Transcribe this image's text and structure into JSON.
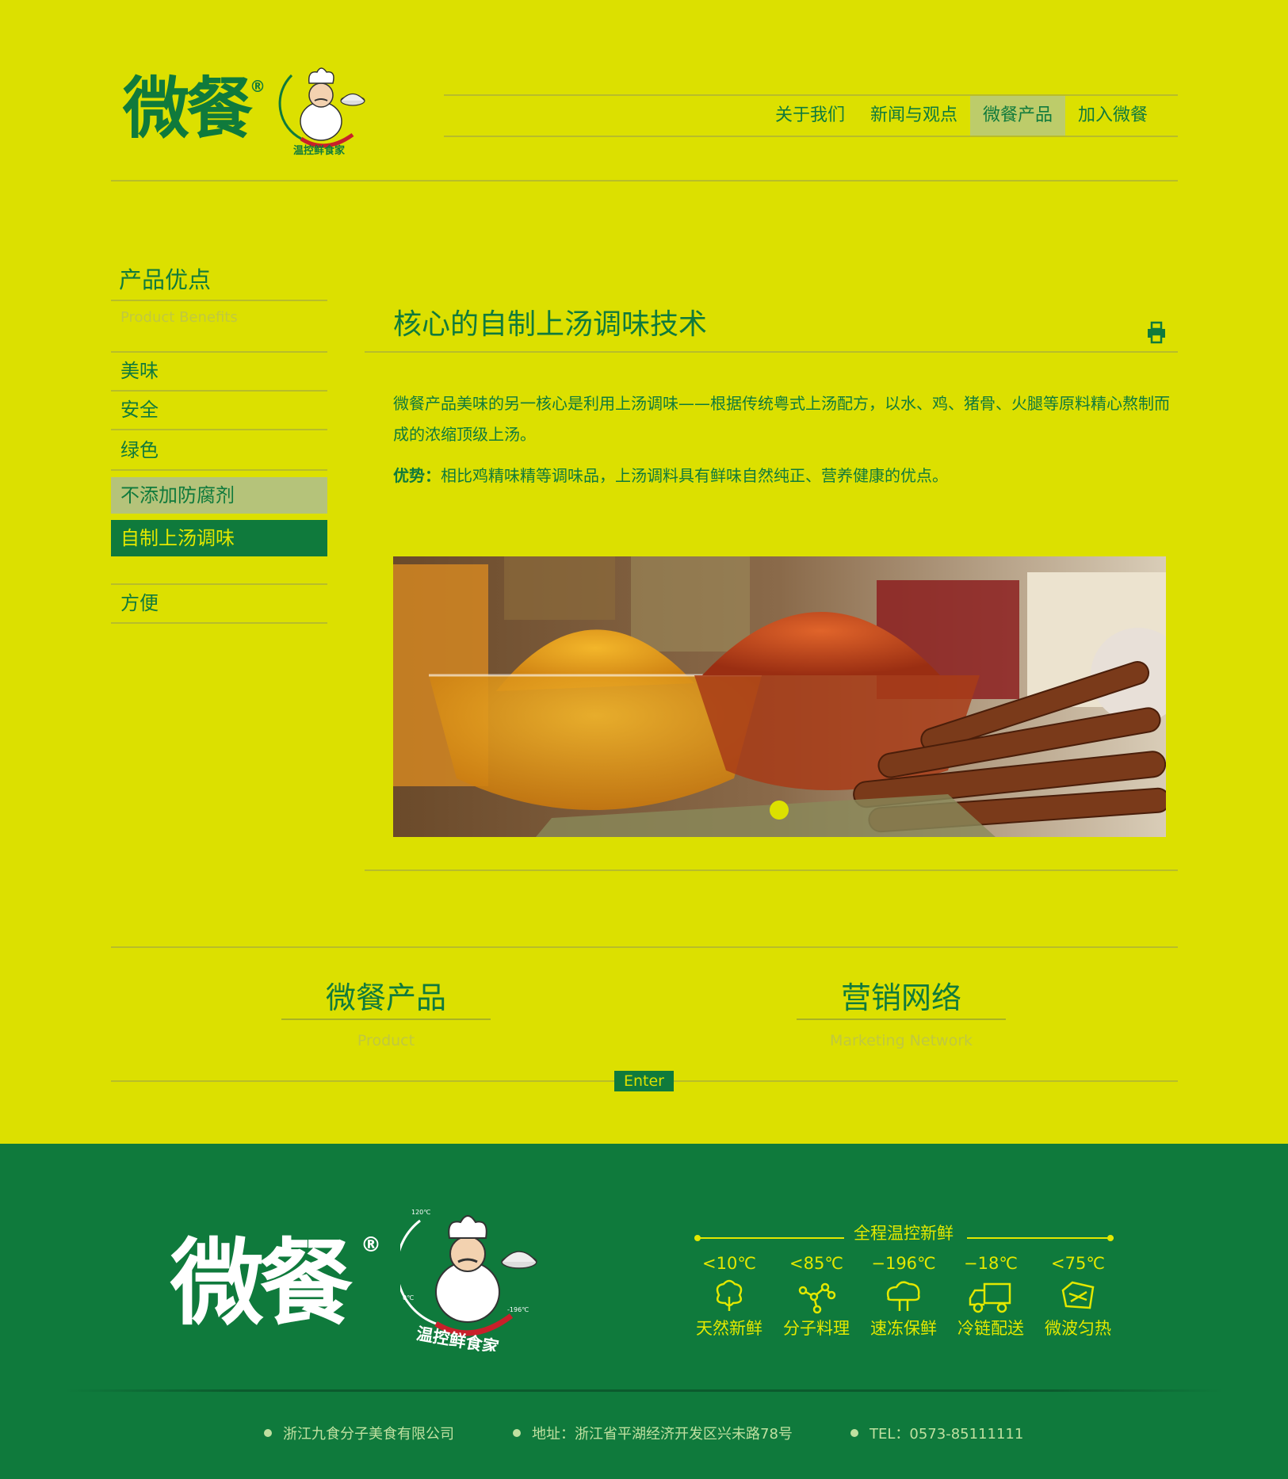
{
  "brand": {
    "logo_text": "微餐",
    "registered": "®",
    "chef_slogan": "温控鲜食家",
    "chef_tm": "™",
    "chef_temp_top": "120℃",
    "chef_temp_left": "0℃",
    "chef_temp_right": "-196℃"
  },
  "nav": {
    "items": [
      {
        "label": "关于我们"
      },
      {
        "label": "新闻与观点"
      },
      {
        "label": "微餐产品",
        "active": true
      },
      {
        "label": "加入微餐"
      }
    ]
  },
  "sidebar": {
    "title": "产品优点",
    "subtitle": "Product Benefits",
    "items": [
      {
        "label": "美味"
      },
      {
        "label": "安全"
      },
      {
        "label": "绿色"
      },
      {
        "label": "不添加防腐剂"
      },
      {
        "label": "自制上汤调味"
      },
      {
        "label": "方便"
      }
    ]
  },
  "content": {
    "title": "核心的自制上汤调味技术",
    "paragraph": "微餐产品美味的另一核心是利用上汤调味——根据传统粤式上汤配方，以水、鸡、猪骨、火腿等原料精心熬制而成的浓缩顶级上汤。",
    "advantage_label": "优势：",
    "advantage_text": "相比鸡精味精等调味品，上汤调料具有鲜味自然纯正、营养健康的优点。",
    "image_alt": "spices"
  },
  "links": {
    "product_title": "微餐产品",
    "product_sub": "Product",
    "network_title": "营销网络",
    "network_sub": "Marketing Network",
    "enter": "Enter"
  },
  "footer": {
    "temp_title": "全程温控新鲜",
    "temps": [
      {
        "value": "<10℃",
        "label": "天然新鲜",
        "icon": "vegetable-icon"
      },
      {
        "value": "<85℃",
        "label": "分子料理",
        "icon": "molecule-icon"
      },
      {
        "value": "−196℃",
        "label": "速冻保鲜",
        "icon": "freeze-icon"
      },
      {
        "value": "−18℃",
        "label": "冷链配送",
        "icon": "truck-icon"
      },
      {
        "value": "<75℃",
        "label": "微波匀热",
        "icon": "microwave-icon"
      }
    ],
    "company": "浙江九食分子美食有限公司",
    "address": "地址：浙江省平湖经济开发区兴未路78号",
    "tel": "TEL：0573-85111111"
  },
  "colors": {
    "background": "#dce000",
    "primary_green": "#0f7a3c",
    "footer_green": "#0f7a3c",
    "accent_yellow": "#e3e800"
  }
}
